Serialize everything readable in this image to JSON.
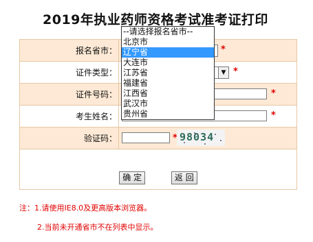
{
  "page_title": "2019年执业药师资格考试准考证打印",
  "form": {
    "province_label": "报名省市：",
    "id_type_label": "证件类型：",
    "id_number_label": "证件号码：",
    "name_label": "考生姓名：",
    "captcha_label": "验证码：",
    "required_mark": "*",
    "captcha_text": "98034"
  },
  "dropdown": {
    "options": [
      "--请选择报名省市--",
      "北京市",
      "辽宁省",
      "大连市",
      "江苏省",
      "福建省",
      "江西省",
      "武汉市",
      "贵州省"
    ],
    "selected_index": 2
  },
  "buttons": {
    "confirm_label": "确 定",
    "back_label": "返 回"
  },
  "notes": {
    "note1": "注：1.请使用IE8.0及更高版本浏览器。",
    "note2": "2.当前未开通省市不在列表中显示。"
  },
  "colors": {
    "row_highlight": "#fde9d5",
    "border": "#e6c7a4",
    "required": "#e00000",
    "selected_option": "#3399ff"
  }
}
